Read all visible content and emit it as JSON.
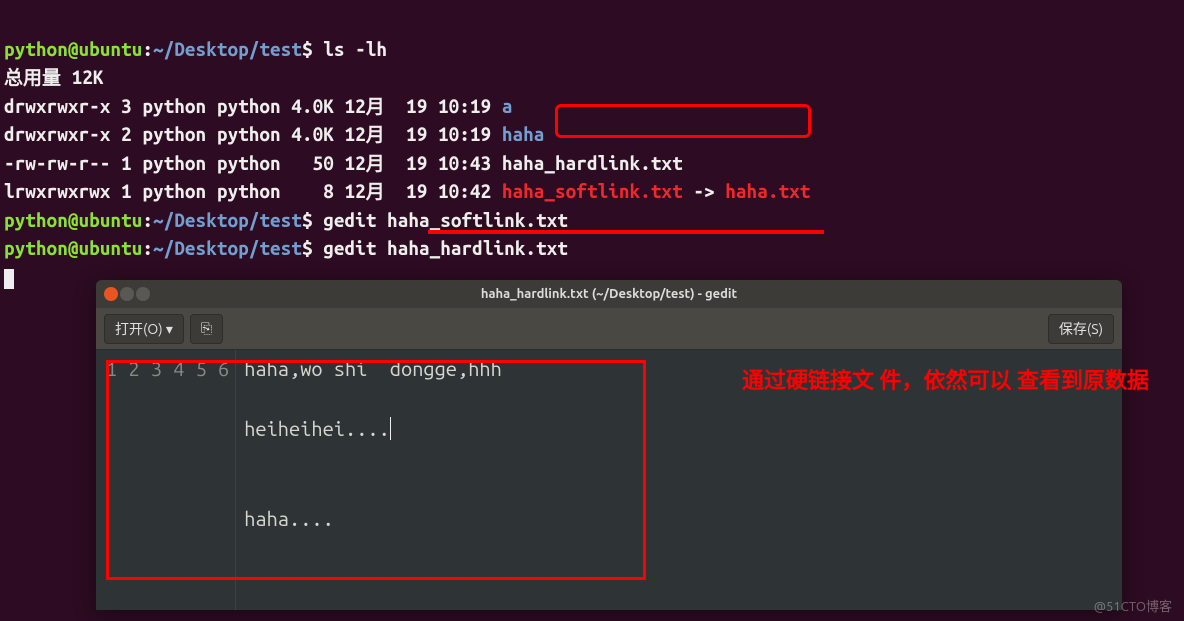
{
  "terminal": {
    "prompt_user": "python@ubuntu",
    "prompt_sep": ":",
    "prompt_path": "~/Desktop/test",
    "prompt_end": "$ ",
    "cmd1": "ls -lh",
    "total_line": "总用量 12K",
    "rows": [
      {
        "perm": "drwxrwxr-x",
        "n": "3",
        "u": "python",
        "g": "python",
        "size": "4.0K",
        "date": "12月  19 10:19",
        "name": "a",
        "class": "dirlink"
      },
      {
        "perm": "drwxrwxr-x",
        "n": "2",
        "u": "python",
        "g": "python",
        "size": "4.0K",
        "date": "12月  19 10:19",
        "name": "haha",
        "class": "dirlink"
      },
      {
        "perm": "-rw-rw-r--",
        "n": "1",
        "u": "python",
        "g": "python",
        "size": "  50",
        "date": "12月  19 10:43",
        "name": "haha_hardlink.txt",
        "class": "cmd"
      },
      {
        "perm": "lrwxrwxrwx",
        "n": "1",
        "u": "python",
        "g": "python",
        "size": "   8",
        "date": "12月  19 10:42",
        "name": "haha_softlink.txt",
        "arrow": " -> ",
        "target": "haha.txt",
        "class": "softlink"
      }
    ],
    "cmd2": "gedit haha_softlink.txt",
    "cmd3": "gedit haha_hardlink.txt"
  },
  "gedit": {
    "title": "haha_hardlink.txt (~/Desktop/test) - gedit",
    "open_label": "打开(O) ▾",
    "new_tab_icon": "⎘",
    "save_label": "保存(S)",
    "lines": [
      "haha,wo shi  dongge,hhh",
      "",
      "heiheihei....",
      "",
      "",
      "haha...."
    ]
  },
  "annotation": "通过硬链接文\n件，依然可以\n查看到原数据",
  "watermark": "@51CTO博客"
}
